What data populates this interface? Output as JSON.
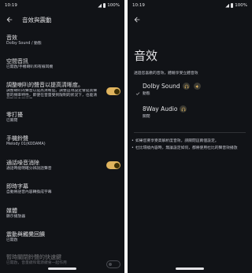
{
  "colors": {
    "background": "#111317",
    "text": "#e3e3e6",
    "accent": "#e0b45e"
  },
  "status": {
    "time": "10:19",
    "battery": "100%"
  },
  "left": {
    "title": "音效與震動",
    "items": [
      {
        "title": "音效",
        "subtitle": "Dolby Sound / 動態"
      },
      {
        "title": "空間音訊",
        "subtitle": "已開啟/手機喇叭和有線耳機"
      },
      {
        "title": "調整喇叭的聲音以提高清晰度。",
        "subtitle": "調整喇叭的聲音以提高清晰度。調整這項設定會提高聲音的頻率特性，即使在音量受到限制的狀況下，也能清楚聽見各項語音。",
        "toggle": true
      },
      {
        "title": "零打擾",
        "subtitle": "已關閉"
      },
      {
        "title": "手機鈴聲",
        "subtitle": "Melody 01(KODAMA)"
      },
      {
        "title": "通話噪音消除",
        "subtitle": "通話時能明確分辨說話聲音",
        "toggle": true
      },
      {
        "title": "即時字幕",
        "subtitle": "自動將語音內容轉換成字幕"
      },
      {
        "title": "媒體",
        "subtitle": "顯示播放器"
      },
      {
        "title": "震動與觸覺回饋",
        "subtitle": "已開啟"
      },
      {
        "title": "暫時關閉鈴聲的快速鍵",
        "subtitle": "已開啟，音量鍵和電源鍵會一起作用",
        "toggle": false
      }
    ]
  },
  "right": {
    "title": "音效",
    "description": "透過您喜歡的音效，體驗享受立體音效",
    "effects": [
      {
        "name": "Dolby Sound",
        "subtitle": "動態",
        "selected": true
      },
      {
        "name": "8Way Audio",
        "subtitle": "關閉",
        "selected": false
      }
    ],
    "notes": [
      "如果您要享受高解析度音效，請關閉這兩個設定。",
      "杜比環繞內容時，無論設定如何，都將使用杜比的聲音效播放"
    ]
  }
}
